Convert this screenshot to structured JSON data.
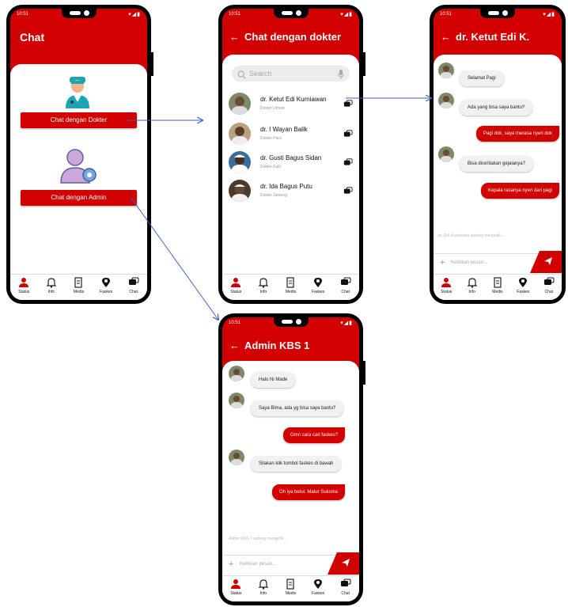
{
  "colors": {
    "primary": "#d30000",
    "arrow": "#3b63b7"
  },
  "status": {
    "time": "10:51",
    "signal": "▾◢▮"
  },
  "nav": [
    {
      "label": "Status",
      "icon": "person-icon"
    },
    {
      "label": "Info",
      "icon": "bell-icon"
    },
    {
      "label": "Medis",
      "icon": "document-icon"
    },
    {
      "label": "Faskes",
      "icon": "location-pin-icon"
    },
    {
      "label": "Chat",
      "icon": "chat-icon"
    }
  ],
  "screen_chat": {
    "title": "Chat",
    "btn_doctor": "Chat dengan Dokter",
    "btn_admin": "Chat dengan Admin"
  },
  "screen_doctors": {
    "title": "Chat dengan dokter",
    "search_placeholder": "Search",
    "doctors": [
      {
        "name": "dr. Ketut Edi Kurniawan",
        "specialty": "Dokter Umum"
      },
      {
        "name": "dr. I Wayan Balik",
        "specialty": "Dokter Paru"
      },
      {
        "name": "dr. Gusti Bagus Sidan",
        "specialty": "Dokter Kulit"
      },
      {
        "name": "dr. Ida Bagus Putu",
        "specialty": "Dokter Jantung"
      }
    ]
  },
  "screen_doctor_chat": {
    "title": "dr. Ketut Edi K.",
    "messages": [
      {
        "side": "left",
        "text": "Selamat Pagi"
      },
      {
        "side": "left",
        "text": "Ada yang bisa saya bantu?"
      },
      {
        "side": "right",
        "text": "Pagi dok, saya merasa nyeri dok"
      },
      {
        "side": "left",
        "text": "Bisa diceritakan gejalanya?"
      },
      {
        "side": "right",
        "text": "Kepala rasanya nyeri dari pagi"
      }
    ],
    "typing": "dr. Edi Kurniawan sedang mengetik...",
    "input_placeholder": "Ketikkan pesan..."
  },
  "screen_admin_chat": {
    "title": "Admin KBS 1",
    "messages": [
      {
        "side": "left",
        "text": "Halo Ni Made"
      },
      {
        "side": "left",
        "text": "Saya Bima, ada yg bisa saya bantu?"
      },
      {
        "side": "right",
        "text": "Gmn cara cari faskes?"
      },
      {
        "side": "left",
        "text": "Silakan klik tombol faskes di bawah"
      },
      {
        "side": "right",
        "text": "Oh iya betul. Matur Suksma"
      }
    ],
    "typing": "Admin KBS 1 sedang mengetik...",
    "input_placeholder": "Ketikkan pesan..."
  }
}
